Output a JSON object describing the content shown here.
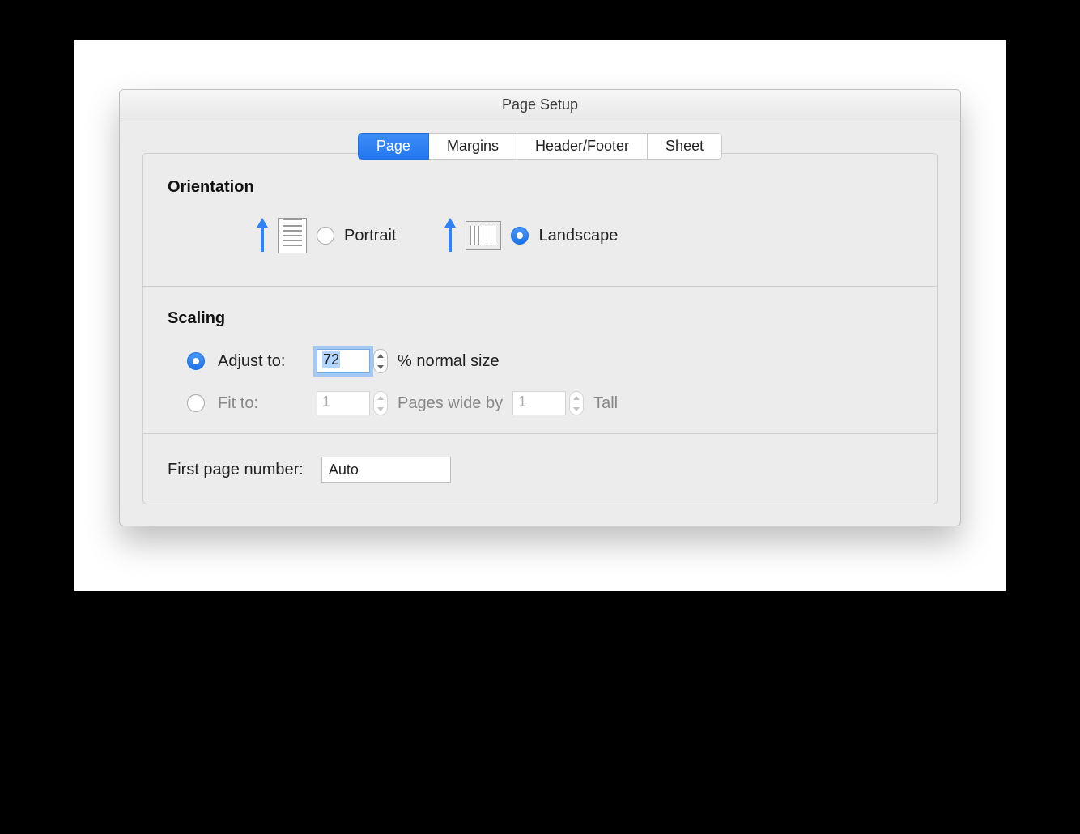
{
  "dialog": {
    "title": "Page Setup",
    "tabs": [
      {
        "label": "Page",
        "active": true
      },
      {
        "label": "Margins",
        "active": false
      },
      {
        "label": "Header/Footer",
        "active": false
      },
      {
        "label": "Sheet",
        "active": false
      }
    ]
  },
  "orientation": {
    "section_label": "Orientation",
    "portrait_label": "Portrait",
    "landscape_label": "Landscape",
    "selected": "landscape"
  },
  "scaling": {
    "section_label": "Scaling",
    "adjust_to_label": "Adjust to:",
    "adjust_value": "72",
    "adjust_suffix": "% normal size",
    "fit_to_label": "Fit to:",
    "fit_wide": "1",
    "fit_middle_text": "Pages wide by",
    "fit_tall": "1",
    "fit_tall_label": "Tall",
    "selected": "adjust"
  },
  "first_page": {
    "label": "First page number:",
    "value": "Auto"
  }
}
